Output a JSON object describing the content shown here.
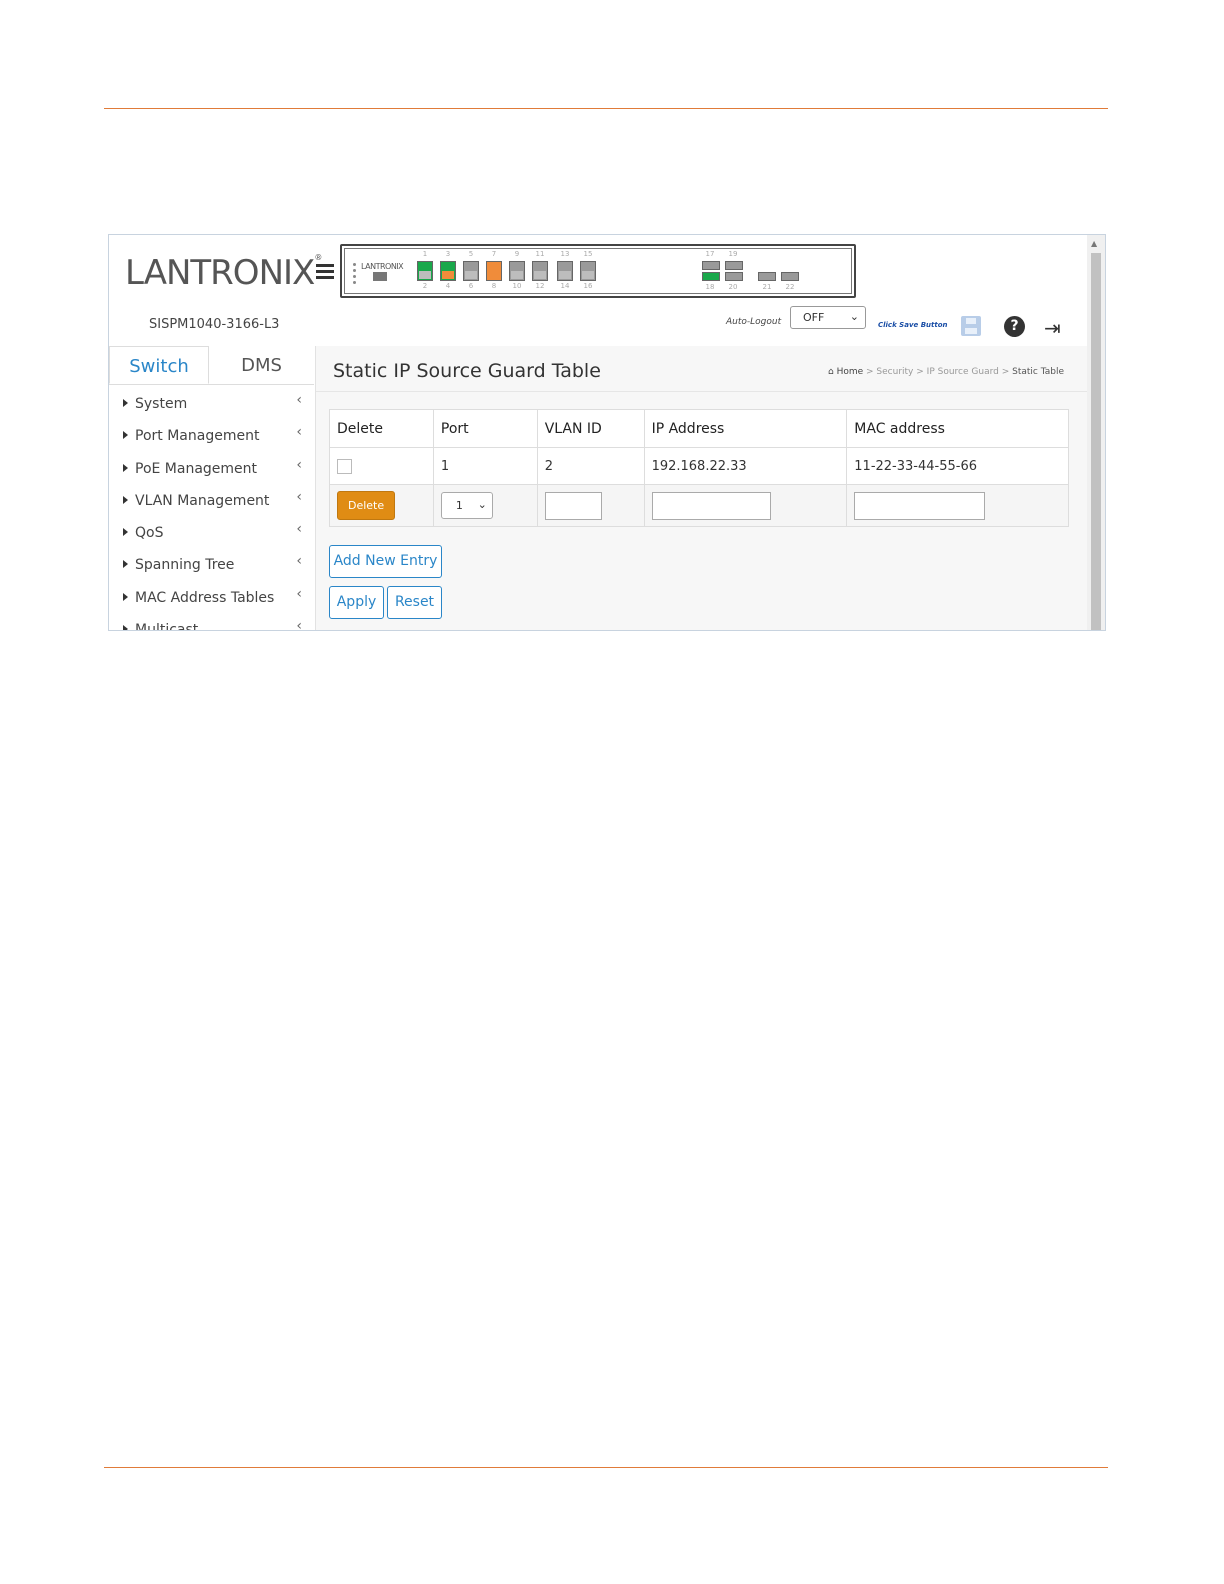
{
  "header": {
    "logo_text": "LANTRONIX",
    "model": "SISPM1040-3166-L3",
    "auto_logout_label": "Auto-Logout",
    "auto_logout_value": "OFF",
    "click_save_label": "Click Save Button"
  },
  "panel": {
    "brand": "LANTRONIX",
    "top_numbers": [
      "1",
      "3",
      "5",
      "7",
      "9",
      "11",
      "13",
      "15"
    ],
    "bottom_numbers": [
      "2",
      "4",
      "6",
      "8",
      "10",
      "12",
      "14",
      "16"
    ],
    "sfp_top_numbers": [
      "17",
      "19"
    ],
    "sfp_bottom_numbers": [
      "18",
      "20",
      "21",
      "22"
    ]
  },
  "sidebar": {
    "tabs": [
      {
        "label": "Switch"
      },
      {
        "label": "DMS"
      }
    ],
    "items": [
      {
        "label": "System"
      },
      {
        "label": "Port Management"
      },
      {
        "label": "PoE Management"
      },
      {
        "label": "VLAN Management"
      },
      {
        "label": "QoS"
      },
      {
        "label": "Spanning Tree"
      },
      {
        "label": "MAC Address Tables"
      },
      {
        "label": "Multicast"
      }
    ]
  },
  "main": {
    "title": "Static IP Source Guard Table",
    "breadcrumb": {
      "home": "Home",
      "items": [
        "Security",
        "IP Source Guard"
      ],
      "current": "Static Table"
    },
    "table": {
      "headers": [
        "Delete",
        "Port",
        "VLAN ID",
        "IP Address",
        "MAC address"
      ],
      "rows": [
        {
          "port": "1",
          "vlan_id": "2",
          "ip": "192.168.22.33",
          "mac": "11-22-33-44-55-66"
        }
      ],
      "new_row": {
        "delete_label": "Delete",
        "port_value": "1"
      }
    },
    "buttons": {
      "add_new_entry": "Add New Entry",
      "apply": "Apply",
      "reset": "Reset"
    }
  },
  "colors": {
    "accent_rule": "#e07b39",
    "link_blue": "#2a86c8",
    "delete_orange": "#e08c14",
    "port_green": "#1aa84b",
    "port_orange": "#f08c3a"
  }
}
